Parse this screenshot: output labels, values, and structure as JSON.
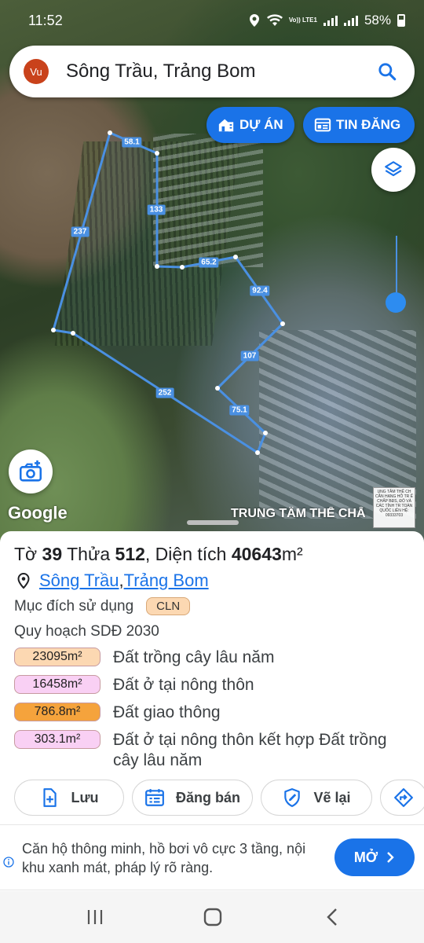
{
  "status_bar": {
    "time": "11:52",
    "volte": "Vo)) LTE1",
    "battery": "58%"
  },
  "search": {
    "avatar": "Vu",
    "query": "Sông Trầu, Trảng Bom",
    "icon": "search-icon"
  },
  "map": {
    "buttons": {
      "du_an": "DỰ ÁN",
      "tin_dang": "TIN ĐĂNG"
    },
    "parcel_edges": [
      "58.1",
      "133",
      "65.2",
      "92.4",
      "107",
      "75.1",
      "252",
      "237"
    ],
    "parcel_color": "#4a90e2",
    "location_dot_color": "#1a73e8",
    "google_logo": "Google",
    "watermark": "TRUNG TÂM THẾ CHẤ",
    "stamp_text": "UNG TÂM THẾ CH CẦN HẠNG HỖ TR Ế CHẤP BĐS, ĐÔ VÀ CÁC TỈNH TR TOÀN QUỐC LIÊN HỆ: 09333703"
  },
  "parcel": {
    "title_prefix": "Tờ ",
    "sheet": "39",
    "title_middle": " Thửa ",
    "lot": "512",
    "title_area_label": ", Diện tích ",
    "area": "40643",
    "area_unit": "m²",
    "commune": "Sông Trầu",
    "separator": ", ",
    "district": "Trảng Bom",
    "purpose_label": "Mục đích sử dụng",
    "purpose_code": "CLN",
    "planning_title": "Quy hoạch SDĐ 2030",
    "zones": [
      {
        "area": "23095m²",
        "label": "Đất trồng cây lâu năm",
        "color": "#fcd8b2"
      },
      {
        "area": "16458m²",
        "label": "Đất ở tại nông thôn",
        "color": "#f9d0f4"
      },
      {
        "area": "786.8m²",
        "label": "Đất giao thông",
        "color": "#f5a33c"
      },
      {
        "area": "303.1m²",
        "label": "Đất ở tại nông thôn kết hợp Đất trồng cây lâu năm",
        "color": "#f9d0f4"
      }
    ]
  },
  "actions": {
    "save": "Lưu",
    "post": "Đăng bán",
    "redraw": "Vẽ lại"
  },
  "ad": {
    "text": "Căn hộ thông minh, hồ bơi vô cực 3 tầng, nội khu xanh mát, pháp lý rõ ràng.",
    "cta": "MỞ"
  }
}
